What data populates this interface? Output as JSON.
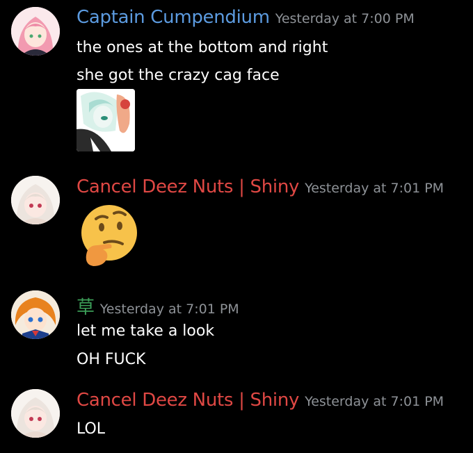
{
  "colors": {
    "background": "#000000",
    "captain_name": "#5c9be0",
    "cancel_name": "#e04844",
    "kusa_name": "#3c9e58",
    "timestamp": "#8e9297"
  },
  "messages": [
    {
      "username": "Captain Cumpendium",
      "timestamp": "Yesterday at 7:00 PM",
      "lines": [
        "the ones at the bottom and right",
        "she got the crazy cag face"
      ],
      "attachment": "image-attachment"
    },
    {
      "username": "Cancel Deez Nuts | Shiny",
      "timestamp": "Yesterday at 7:01 PM",
      "emoji": "thinking-face-emoji"
    },
    {
      "username": "草",
      "timestamp": "Yesterday at 7:01 PM",
      "lines": [
        "let me take a look",
        "OH FUCK"
      ]
    },
    {
      "username": "Cancel Deez Nuts | Shiny",
      "timestamp": "Yesterday at 7:01 PM",
      "lines": [
        "LOL"
      ]
    }
  ]
}
